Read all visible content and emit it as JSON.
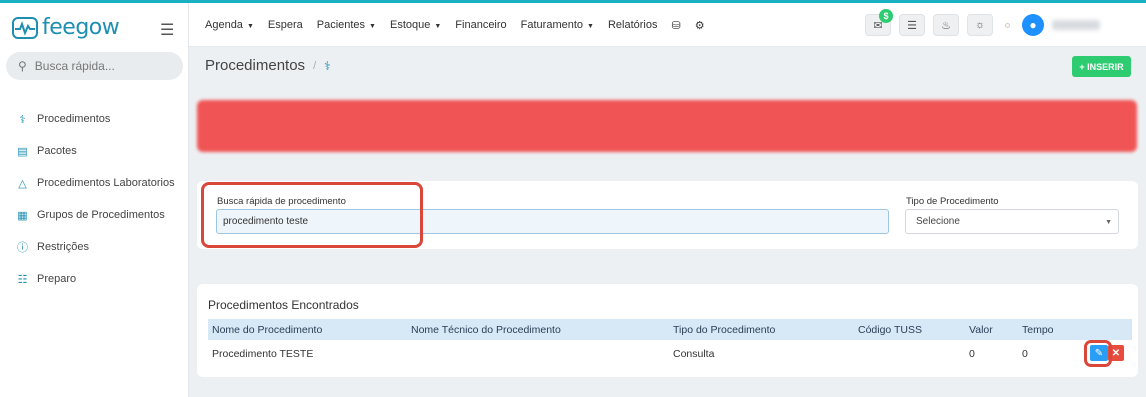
{
  "app": {
    "logo_text": "feegow",
    "accent_color": "#1e8fb1"
  },
  "sidebar": {
    "search_placeholder": "Busca rápida...",
    "items": [
      {
        "label": "Procedimentos",
        "icon": "stethoscope-icon"
      },
      {
        "label": "Pacotes",
        "icon": "box-icon"
      },
      {
        "label": "Procedimentos Laboratorios",
        "icon": "flask-icon"
      },
      {
        "label": "Grupos de Procedimentos",
        "icon": "group-icon"
      },
      {
        "label": "Restrições",
        "icon": "exclamation-circle-icon"
      },
      {
        "label": "Preparo",
        "icon": "list-icon"
      }
    ]
  },
  "topbar": {
    "menu": [
      {
        "label": "Agenda",
        "dropdown": true
      },
      {
        "label": "Espera",
        "dropdown": false
      },
      {
        "label": "Pacientes",
        "dropdown": true
      },
      {
        "label": "Estoque",
        "dropdown": true
      },
      {
        "label": "Financeiro",
        "dropdown": false
      },
      {
        "label": "Faturamento",
        "dropdown": true
      },
      {
        "label": "Relatórios",
        "dropdown": false
      }
    ],
    "badge_value": "$"
  },
  "page": {
    "title": "Procedimentos",
    "breadcrumb_sep": "/",
    "insert_button": "+ INSERIR"
  },
  "filters": {
    "busca_label": "Busca rápida de procedimento",
    "busca_value": "procedimento teste",
    "tipo_label": "Tipo de Procedimento",
    "tipo_value": "Selecione"
  },
  "results": {
    "title": "Procedimentos Encontrados",
    "columns": [
      "Nome do Procedimento",
      "Nome Técnico do Procedimento",
      "Tipo do Procedimento",
      "Código TUSS",
      "Valor",
      "Tempo"
    ],
    "rows": [
      {
        "nome": "Procedimento TESTE",
        "nome_tecnico": "",
        "tipo": "Consulta",
        "tuss": "",
        "valor": "0",
        "tempo": "0"
      }
    ]
  },
  "colors": {
    "alert": "#f05454",
    "success": "#2ecc71",
    "table_header": "#d7e9f7",
    "highlight": "#d9473b"
  }
}
